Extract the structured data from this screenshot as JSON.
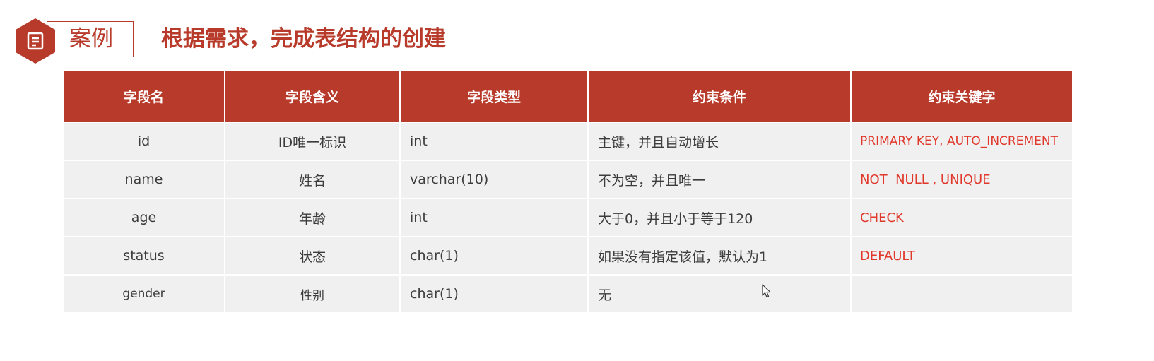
{
  "header": {
    "tag_label": "案例",
    "title": "根据需求，完成表结构的创建"
  },
  "table": {
    "columns": [
      "字段名",
      "字段含义",
      "字段类型",
      "约束条件",
      "约束关键字"
    ],
    "rows": [
      {
        "name": "id",
        "meaning": "ID唯一标识",
        "type": "int",
        "constraint": "主键，并且自动增长",
        "keyword": "PRIMARY KEY, AUTO_INCREMENT"
      },
      {
        "name": "name",
        "meaning": "姓名",
        "type": "varchar(10)",
        "constraint": "不为空，并且唯一",
        "keyword": "NOT  NULL , UNIQUE"
      },
      {
        "name": "age",
        "meaning": "年龄",
        "type": "int",
        "constraint": "大于0，并且小于等于120",
        "keyword": "CHECK"
      },
      {
        "name": "status",
        "meaning": "状态",
        "type": "char(1)",
        "constraint": "如果没有指定该值，默认为1",
        "keyword": "DEFAULT"
      },
      {
        "name": "gender",
        "meaning": "性别",
        "type": "char(1)",
        "constraint": "无",
        "keyword": ""
      }
    ]
  },
  "colors": {
    "accent": "#b83a2a",
    "keyword_red": "#e0382b",
    "row_bg": "#f0f0f0"
  },
  "icons": {
    "badge": "document-list-icon",
    "cursor": "mouse-pointer-icon"
  }
}
